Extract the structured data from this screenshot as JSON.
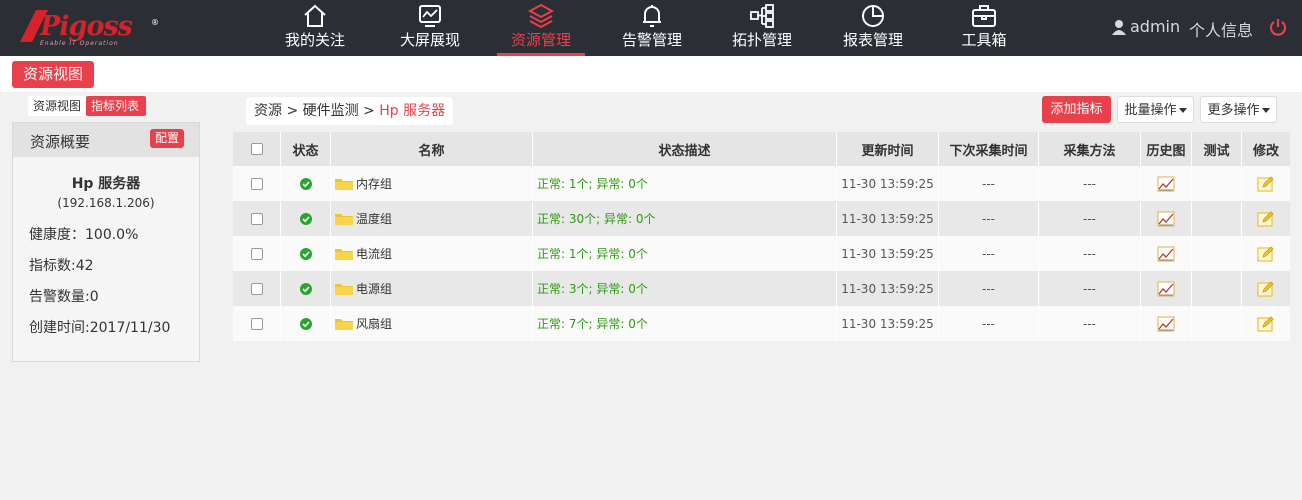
{
  "brand": {
    "logo_text": "Pigoss",
    "logo_sub": "Enable IT Operation",
    "logo_reg": "®"
  },
  "nav": [
    {
      "label": "我的关注",
      "icon": "home-icon"
    },
    {
      "label": "大屏展现",
      "icon": "monitor-icon"
    },
    {
      "label": "资源管理",
      "icon": "layers-icon",
      "active": true
    },
    {
      "label": "告警管理",
      "icon": "bell-icon"
    },
    {
      "label": "拓扑管理",
      "icon": "topology-icon"
    },
    {
      "label": "报表管理",
      "icon": "pie-icon"
    },
    {
      "label": "工具箱",
      "icon": "toolbox-icon"
    }
  ],
  "user": {
    "name": "admin",
    "profile": "个人信息"
  },
  "subbar": {
    "view_button": "资源视图"
  },
  "left_tabs": {
    "tab1": "资源视图",
    "tab2": "指标列表"
  },
  "panel": {
    "title": "资源概要",
    "config": "配置",
    "name": "Hp 服务器",
    "ip": "(192.168.1.206)",
    "health": "健康度：100.0%",
    "metrics": "指标数:42",
    "alerts": "告警数量:0",
    "created": "创建时间:2017/11/30"
  },
  "breadcrumb": {
    "a": "资源",
    "sep1": ">",
    "b": "硬件监测",
    "sep2": ">",
    "current": "Hp 服务器"
  },
  "actions": {
    "add": "添加指标",
    "batch": "批量操作",
    "more": "更多操作"
  },
  "table": {
    "headers": [
      "状态",
      "名称",
      "状态描述",
      "更新时间",
      "下次采集时间",
      "采集方法",
      "历史图",
      "测试",
      "修改"
    ],
    "rows": [
      {
        "name": "内存组",
        "desc": "正常: 1个; 异常: 0个",
        "time": "11-30 13:59:25",
        "next": "---",
        "method": "---"
      },
      {
        "name": "温度组",
        "desc": "正常: 30个; 异常: 0个",
        "time": "11-30 13:59:25",
        "next": "---",
        "method": "---"
      },
      {
        "name": "电流组",
        "desc": "正常: 1个; 异常: 0个",
        "time": "11-30 13:59:25",
        "next": "---",
        "method": "---"
      },
      {
        "name": "电源组",
        "desc": "正常: 3个; 异常: 0个",
        "time": "11-30 13:59:25",
        "next": "---",
        "method": "---"
      },
      {
        "name": "风扇组",
        "desc": "正常: 7个; 异常: 0个",
        "time": "11-30 13:59:25",
        "next": "---",
        "method": "---"
      }
    ]
  },
  "colors": {
    "accent": "#e8414b",
    "header_bg": "#2b2e35",
    "ok_green": "#27a52c",
    "desc_green": "#2d9a0f"
  }
}
